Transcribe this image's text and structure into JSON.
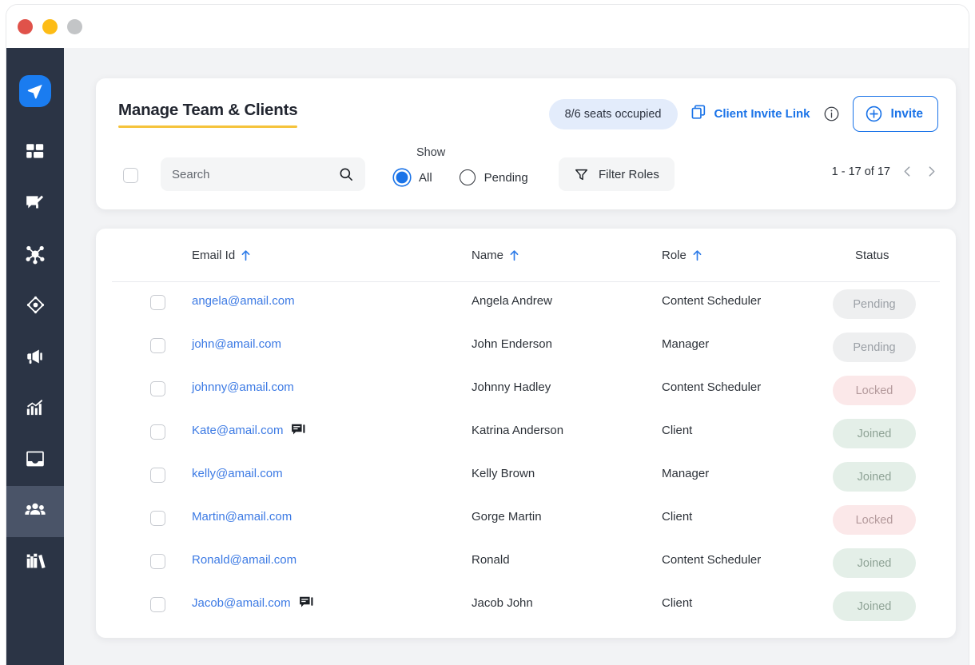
{
  "window": {
    "dots": [
      {
        "name": "close",
        "color": "#e0524a"
      },
      {
        "name": "minimize",
        "color": "#fdbc16"
      },
      {
        "name": "maximize",
        "color": "#c3c5c7"
      }
    ]
  },
  "sidebar": {
    "logo": "send-logo-icon",
    "items": [
      {
        "icon": "dashboard-grid-icon",
        "active": false
      },
      {
        "icon": "compose-message-icon",
        "active": false
      },
      {
        "icon": "network-nodes-icon",
        "active": false
      },
      {
        "icon": "target-compass-icon",
        "active": false
      },
      {
        "icon": "megaphone-icon",
        "active": false
      },
      {
        "icon": "analytics-chart-icon",
        "active": false
      },
      {
        "icon": "inbox-download-icon",
        "active": false
      },
      {
        "icon": "team-users-icon",
        "active": true
      },
      {
        "icon": "library-books-icon",
        "active": false
      }
    ]
  },
  "header": {
    "title": "Manage Team & Clients",
    "seats_pill": "8/6 seats occupied",
    "client_invite_link": "Client Invite Link",
    "copy_icon": "copy-icon",
    "info_icon": "info-circle-icon",
    "invite_button": "Invite",
    "invite_icon": "plus-circle-icon",
    "accent_blue": "#1a73e8",
    "underline_yellow": "#f5c33b"
  },
  "toolbar": {
    "select_all_name": "select-all-checkbox",
    "search": {
      "value": "",
      "placeholder": "Search",
      "icon": "search-icon"
    },
    "show_label": "Show",
    "radios": [
      {
        "label": "All",
        "selected": true
      },
      {
        "label": "Pending",
        "selected": false
      }
    ],
    "filter_roles": {
      "label": "Filter Roles",
      "icon": "filter-funnel-icon"
    },
    "pagination": {
      "range": "1 - 17 of 17",
      "prev_icon": "chevron-left-icon",
      "next_icon": "chevron-right-icon"
    }
  },
  "table": {
    "columns": [
      {
        "label": "Email Id",
        "sortable": true
      },
      {
        "label": "Name",
        "sortable": true
      },
      {
        "label": "Role",
        "sortable": true
      },
      {
        "label": "Status",
        "sortable": false
      }
    ],
    "rows": [
      {
        "email": "angela@amail.com",
        "chat": false,
        "name": "Angela Andrew",
        "role": "Content Scheduler",
        "status": "Pending",
        "status_kind": "pending"
      },
      {
        "email": "john@amail.com",
        "chat": false,
        "name": "John Enderson",
        "role": "Manager",
        "status": "Pending",
        "status_kind": "pending"
      },
      {
        "email": "johnny@amail.com",
        "chat": false,
        "name": "Johnny Hadley",
        "role": "Content Scheduler",
        "status": "Locked",
        "status_kind": "locked"
      },
      {
        "email": "Kate@amail.com",
        "chat": true,
        "name": "Katrina Anderson",
        "role": "Client",
        "status": "Joined",
        "status_kind": "joined"
      },
      {
        "email": "kelly@amail.com",
        "chat": false,
        "name": "Kelly Brown",
        "role": "Manager",
        "status": "Joined",
        "status_kind": "joined"
      },
      {
        "email": "Martin@amail.com",
        "chat": false,
        "name": "Gorge Martin",
        "role": "Client",
        "status": "Locked",
        "status_kind": "locked"
      },
      {
        "email": "Ronald@amail.com",
        "chat": false,
        "name": "Ronald",
        "role": "Content Scheduler",
        "status": "Joined",
        "status_kind": "joined"
      },
      {
        "email": "Jacob@amail.com",
        "chat": true,
        "name": "Jacob John",
        "role": "Client",
        "status": "Joined",
        "status_kind": "joined"
      }
    ]
  }
}
